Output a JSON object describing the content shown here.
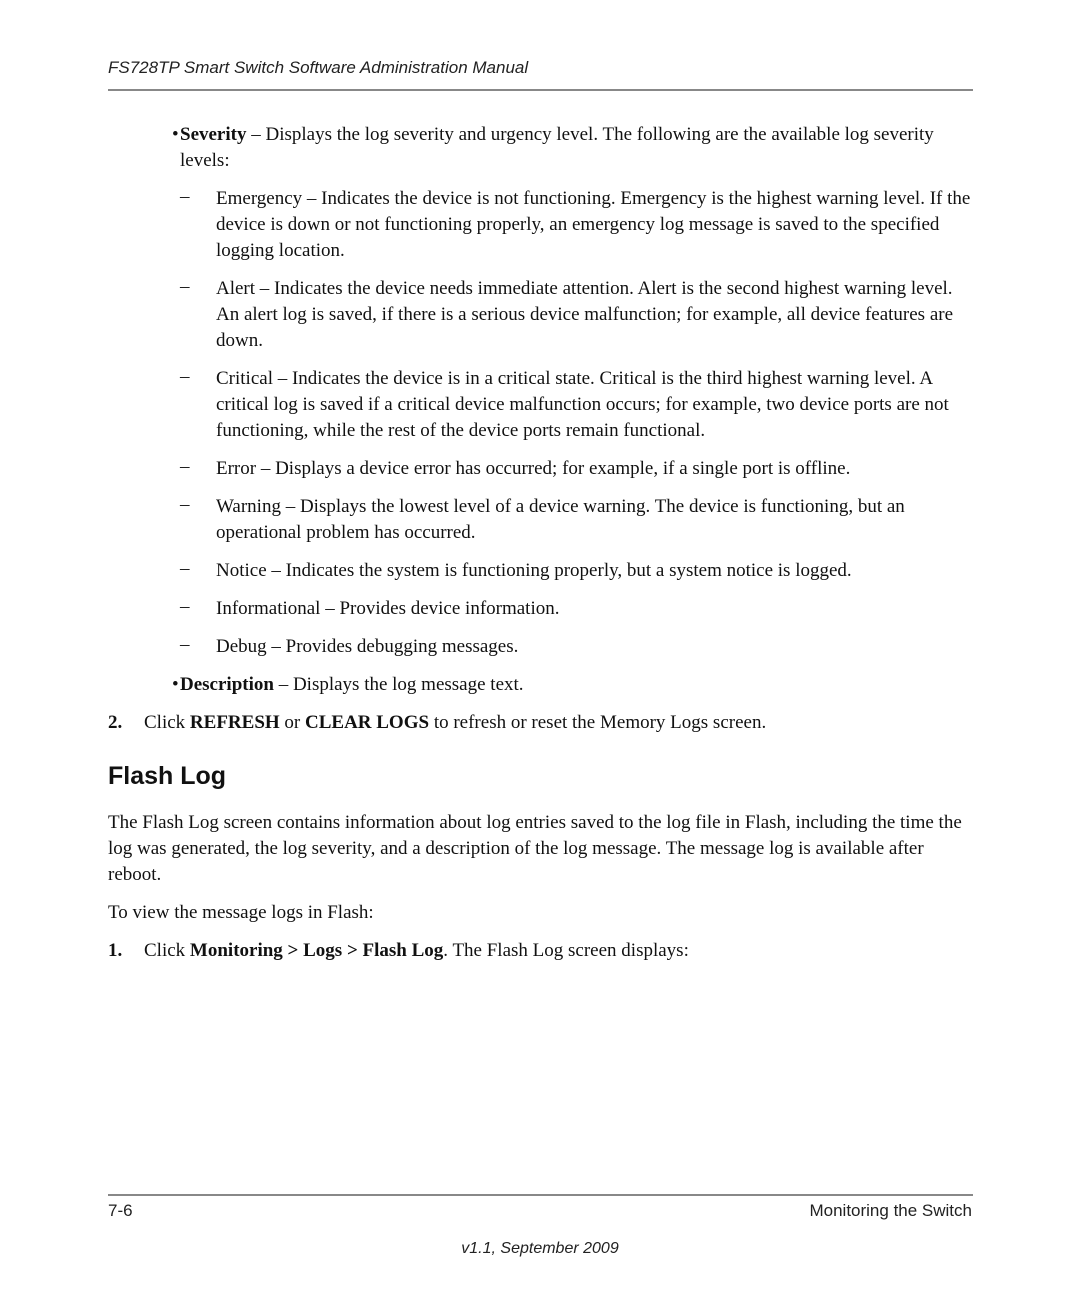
{
  "header": {
    "title": "FS728TP Smart Switch Software Administration Manual"
  },
  "severity_bullet": {
    "term": "Severity",
    "text": " – Displays the log severity and urgency level. The following are the available log severity levels:"
  },
  "levels": [
    {
      "text": "Emergency – Indicates the device is not functioning. Emergency is the highest warning level. If the device is down or not functioning properly, an emergency log message is saved to the specified logging location."
    },
    {
      "text": "Alert – Indicates the device needs immediate attention. Alert is the second highest warning level. An alert log is saved, if there is a serious device malfunction; for example, all device features are down."
    },
    {
      "text": "Critical – Indicates the device is in a critical state. Critical is the third highest warning level. A critical log is saved if a critical device malfunction occurs; for example, two device ports are not functioning, while the rest of the device ports remain functional."
    },
    {
      "text": "Error – Displays a device error has occurred; for example, if a single port is offline."
    },
    {
      "text": "Warning – Displays the lowest level of a device warning. The device is functioning, but an operational problem has occurred."
    },
    {
      "text": "Notice – Indicates the system is functioning properly, but a system notice is logged."
    },
    {
      "text": "Informational – Provides device information."
    },
    {
      "text": "Debug – Provides debugging messages."
    }
  ],
  "description_bullet": {
    "term": "Description",
    "text": " – Displays the log message text."
  },
  "step2": {
    "num": "2.",
    "pre": "Click ",
    "b1": "REFRESH",
    "mid": " or ",
    "b2": "CLEAR LOGS",
    "post": " to refresh or reset the Memory Logs screen."
  },
  "section": {
    "title": "Flash Log",
    "intro": "The Flash Log screen contains information about log entries saved to the log file in Flash, including the time the log was generated, the log severity, and a description of the log message. The message log is available after reboot.",
    "view": "To view the message logs in Flash:",
    "step1": {
      "num": "1.",
      "pre": "Click ",
      "bold": "Monitoring > Logs > Flash Log",
      "post": ". The Flash Log screen displays:"
    }
  },
  "footer": {
    "page": "7-6",
    "chapter": "Monitoring the Switch",
    "version": "v1.1, September 2009"
  }
}
